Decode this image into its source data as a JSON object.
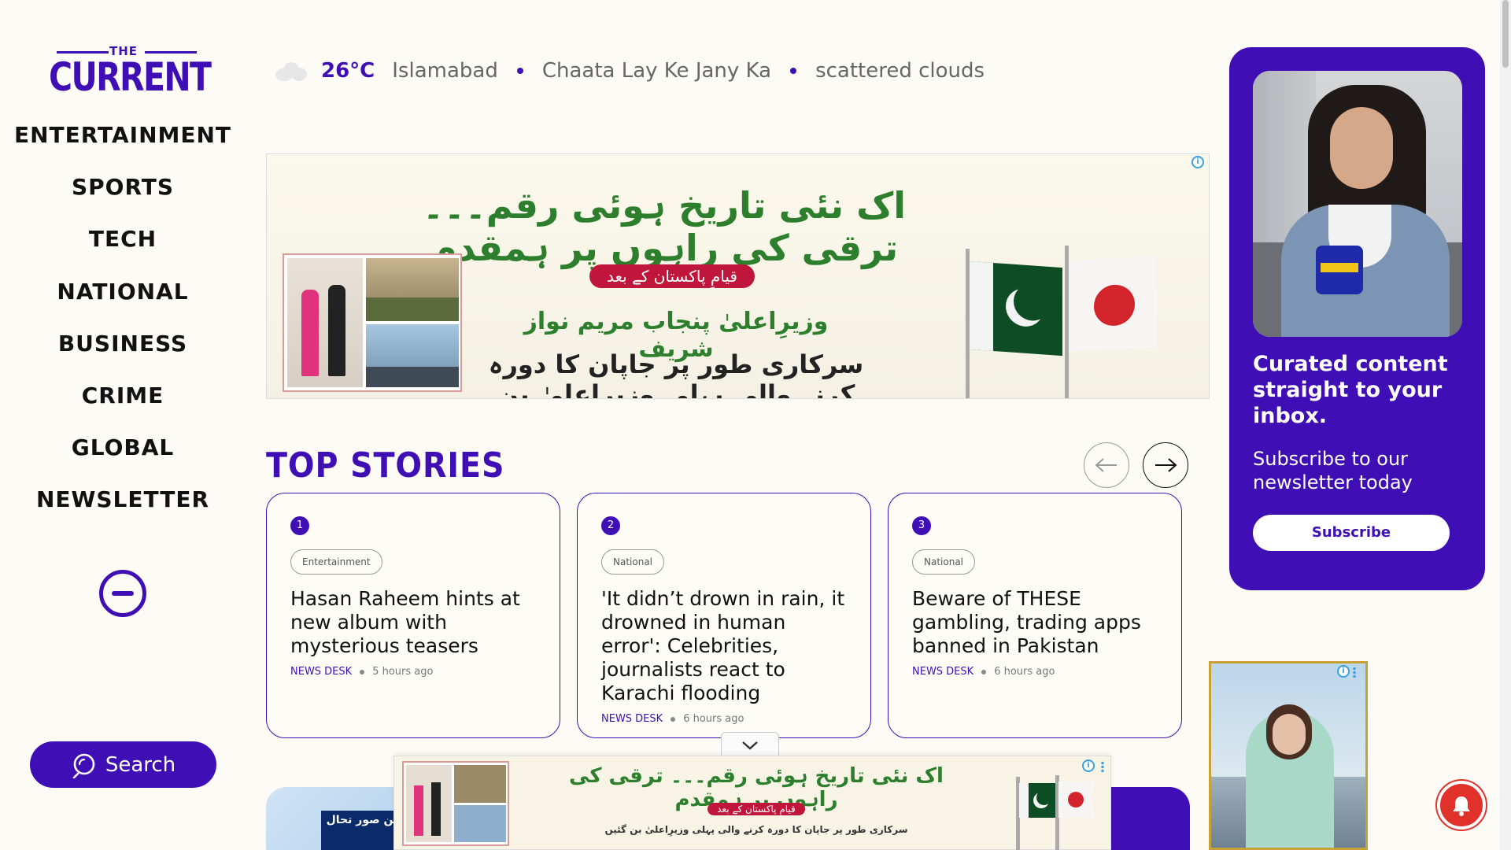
{
  "brand": {
    "logo_small": "THE",
    "logo_main": "CURRENT"
  },
  "nav": {
    "items": [
      {
        "label": "ENTERTAINMENT"
      },
      {
        "label": "SPORTS"
      },
      {
        "label": "TECH"
      },
      {
        "label": "NATIONAL"
      },
      {
        "label": "BUSINESS"
      },
      {
        "label": "CRIME"
      },
      {
        "label": "GLOBAL"
      },
      {
        "label": "NEWSLETTER"
      }
    ],
    "search_label": "Search"
  },
  "weather": {
    "icon": "cloud-icon",
    "temperature": "26°C",
    "city": "Islamabad",
    "tagline": "Chaata Lay Ke Jany Ka",
    "condition": "scattered clouds"
  },
  "banner_ad": {
    "headline": "اک نئی تاریخ ہوئی رقم۔۔۔ ترقی کی راہوں پر ہمقدم",
    "pill": "قیامِ پاکستان کے بعد",
    "line2": "وزیرِاعلیٰ پنجاب مریم نواز شریف",
    "line3": "سرکاری طور پر جاپان کا دورہ کرنے والی پہلی وزیرِاعلیٰ بن گئیں",
    "info_symbol": "i"
  },
  "top_stories": {
    "title": "TOP STORIES",
    "cards": [
      {
        "number": "1",
        "tag": "Entertainment",
        "headline": "Hasan Raheem hints at new album with mysterious teasers",
        "author": "NEWS DESK",
        "time": "5 hours ago"
      },
      {
        "number": "2",
        "tag": "National",
        "headline": "'It didn’t drown in rain, it drowned in human error': Celebrities, journalists react to Karachi flooding",
        "author": "NEWS DESK",
        "time": "6 hours ago"
      },
      {
        "number": "3",
        "tag": "National",
        "headline": "Beware of THESE gambling, trading apps banned in Pakistan",
        "author": "NEWS DESK",
        "time": "6 hours ago"
      }
    ]
  },
  "newsletter": {
    "title": "Curated content straight to your inbox.",
    "subtitle": "Subscribe to our newsletter today",
    "button": "Subscribe"
  },
  "bottom_card": {
    "urdu_caption": "ترین صور تحال"
  },
  "colors": {
    "brand_purple": "#3f0fb5",
    "background": "#fcfbf5",
    "urdu_green": "#2d7f2d",
    "pill_red": "#c0163b",
    "bell_red": "#e0312a"
  }
}
